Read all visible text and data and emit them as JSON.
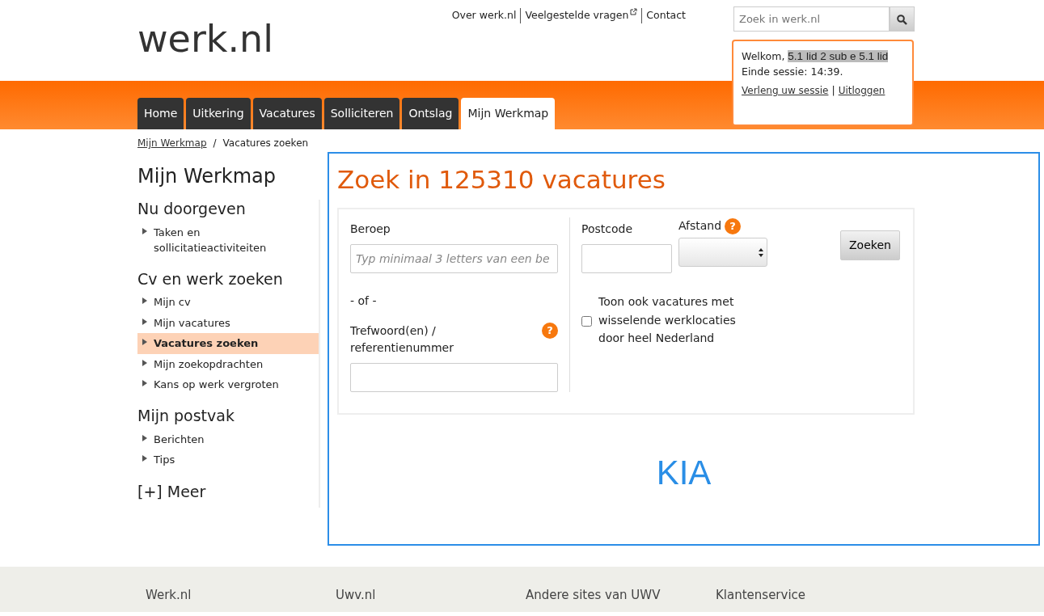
{
  "logo": "werk.nl",
  "top_links": [
    {
      "label": "Over werk.nl",
      "external": false
    },
    {
      "label": "Veelgestelde vragen",
      "external": true
    },
    {
      "label": "Contact",
      "external": false
    }
  ],
  "site_search": {
    "placeholder": "Zoek in werk.nl"
  },
  "session": {
    "welcome": "Welkom,",
    "user": "5.1 lid 2 sub e 5.1 lid",
    "expiry": "Einde sessie: 14:39.",
    "links": [
      "Verleng uw sessie",
      "Uitloggen"
    ],
    "separator": "|"
  },
  "nav_tabs": [
    {
      "label": "Home",
      "selected": false
    },
    {
      "label": "Uitkering",
      "selected": false
    },
    {
      "label": "Vacatures",
      "selected": false
    },
    {
      "label": "Solliciteren",
      "selected": false
    },
    {
      "label": "Ontslag",
      "selected": false
    },
    {
      "label": "Mijn Werkmap",
      "selected": true
    }
  ],
  "breadcrumb": {
    "items": [
      {
        "label": "Mijn Werkmap",
        "link": true
      },
      {
        "label": "Vacatures zoeken",
        "link": false
      }
    ],
    "separator": "/"
  },
  "sidebar": {
    "title": "Mijn Werkmap",
    "groups": [
      {
        "heading": "Nu doorgeven",
        "items": [
          {
            "label": "Taken en sollicitatieactiviteiten",
            "selected": false
          }
        ]
      },
      {
        "heading": "Cv en werk zoeken",
        "items": [
          {
            "label": "Mijn cv",
            "selected": false
          },
          {
            "label": "Mijn vacatures",
            "selected": false
          },
          {
            "label": "Vacatures zoeken",
            "selected": true
          },
          {
            "label": "Mijn zoekopdrachten",
            "selected": false
          },
          {
            "label": "Kans op werk vergroten",
            "selected": false
          }
        ]
      },
      {
        "heading": "Mijn postvak",
        "items": [
          {
            "label": "Berichten",
            "selected": false
          },
          {
            "label": "Tips",
            "selected": false
          }
        ]
      }
    ],
    "more": "[+] Meer"
  },
  "main": {
    "title": "Zoek in 125310 vacatures",
    "form": {
      "beroep": {
        "label": "Beroep",
        "placeholder": "Typ minimaal 3 letters van een be"
      },
      "or_text": "- of -",
      "trefwoord": {
        "label": "Trefwoord(en) / referentienummer",
        "help": "?"
      },
      "postcode": {
        "label": "Postcode"
      },
      "afstand": {
        "label": "Afstand",
        "help": "?"
      },
      "nationwide": {
        "label": "Toon ook vacatures met wisselende werklocaties door heel Nederland",
        "checked": false
      },
      "submit": "Zoeken"
    },
    "annotation": "KIA"
  },
  "footer": [
    "Werk.nl",
    "Uwv.nl",
    "Andere sites van UWV",
    "Klantenservice"
  ]
}
